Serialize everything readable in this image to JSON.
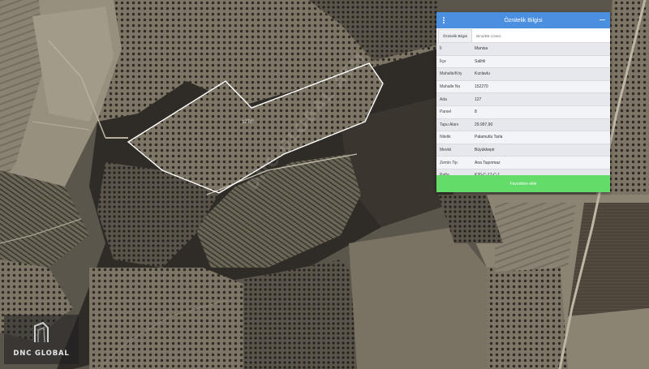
{
  "panel": {
    "title": "Öznitelik Bilgisi",
    "menu_icon": "vertical-dots-icon",
    "collapse_icon": "minus-icon",
    "header_color": "#4b8fe0",
    "tabs": [
      {
        "label": "Öznitelik Bilgisi",
        "active": true
      },
      {
        "label": "Bina/BB Listesi",
        "active": false
      }
    ],
    "rows": [
      {
        "label": "İl",
        "value": "Manisa"
      },
      {
        "label": "İlçe",
        "value": "Salihli"
      },
      {
        "label": "Mahalle/Köy",
        "value": "Kızılavlu"
      },
      {
        "label": "Mahalle No",
        "value": "152270"
      },
      {
        "label": "Ada",
        "value": "127"
      },
      {
        "label": "Parsel",
        "value": "8"
      },
      {
        "label": "Tapu Alanı",
        "value": "29.997,90"
      },
      {
        "label": "Nitelik",
        "value": "Palamutlu Tarla"
      },
      {
        "label": "Mevkii",
        "value": "Büyükkepir"
      },
      {
        "label": "Zemin Tip",
        "value": "Ana Taşınmaz"
      },
      {
        "label": "Pafta",
        "value": "K20-C-17-C-1"
      }
    ],
    "action_label": "Favorilere ekle",
    "action_color": "#64dc6a"
  },
  "map": {
    "parcel_label": "127/8",
    "watermark": "DNC GLOBAL ATM",
    "logo_text": "DNC GLOBAL",
    "parcel_outline_color": "#ffffff"
  }
}
